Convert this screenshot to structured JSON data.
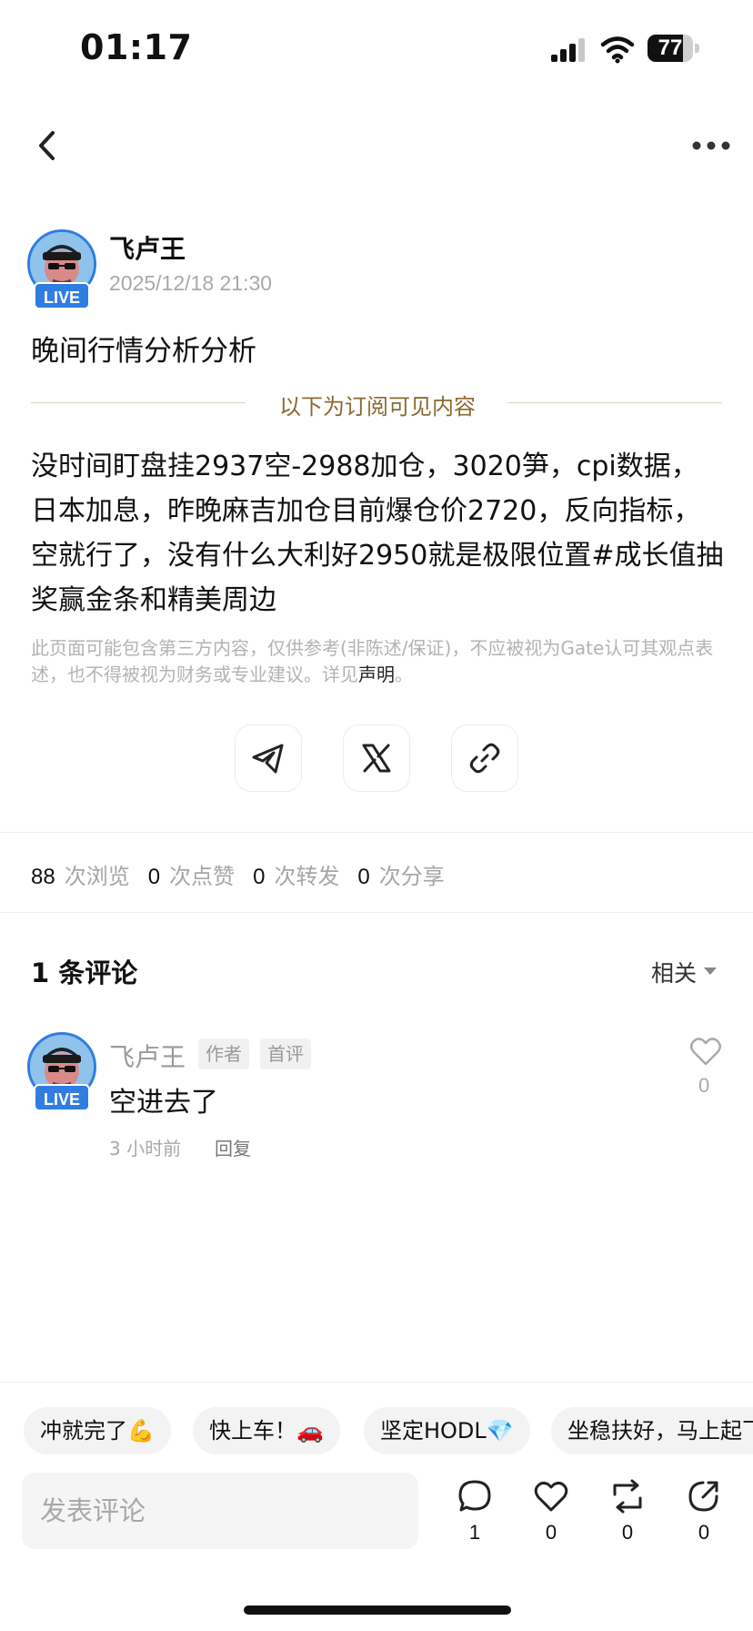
{
  "status_bar": {
    "time": "01:17",
    "battery": "77",
    "battery_level": 0.77
  },
  "author": {
    "name": "飞卢王",
    "badge": "LIVE",
    "post_time": "2025/12/18 21:30"
  },
  "post": {
    "title": "晚间行情分析分析",
    "subscriber_divider": "以下为订阅可见内容",
    "content": "没时间盯盘挂2937空-2988加仓，3020笋，cpi数据，日本加息，昨晚麻吉加仓目前爆仓价2720，反向指标，空就行了，没有什么大利好2950就是极限位置#成长值抽奖赢金条和精美周边",
    "disclaimer": "此页面可能包含第三方内容，仅供参考(非陈述/保证)，不应被视为Gate认可其观点表述，也不得被视为财务或专业建议。详见",
    "disclaimer_link": "声明",
    "disclaimer_end": "。"
  },
  "share": {
    "icons": [
      "telegram-icon",
      "x-icon",
      "link-icon"
    ]
  },
  "stats": {
    "views": "88",
    "views_label": "次浏览",
    "likes": "0",
    "likes_label": "次点赞",
    "reposts": "0",
    "reposts_label": "次转发",
    "shares": "0",
    "shares_label": "次分享"
  },
  "comments_section": {
    "count_label": "1 条评论",
    "sort_label": "相关",
    "items": [
      {
        "name": "飞卢王",
        "badge": "LIVE",
        "tags": [
          "作者",
          "首评"
        ],
        "text": "空进去了",
        "time": "3 小时前",
        "reply": "回复",
        "likes": "0"
      }
    ]
  },
  "quick_replies": [
    "冲就完了💪",
    "快上车！🚗",
    "坚定HODL💎",
    "坐稳扶好，马上起飞"
  ],
  "comment_input": {
    "placeholder": "发表评论"
  },
  "action_bar": {
    "comments": "1",
    "likes": "0",
    "reposts": "0",
    "shares": "0"
  },
  "colors": {
    "accent": "#2f7de1",
    "gold": "#8c6a30",
    "muted": "#a9a9a9"
  }
}
